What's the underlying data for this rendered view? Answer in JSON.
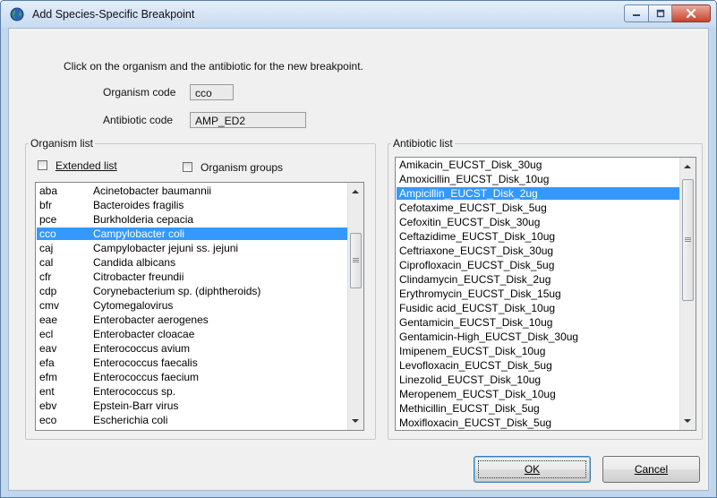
{
  "window": {
    "title": "Add Species-Specific Breakpoint",
    "icon": "globe-icon",
    "controls": [
      "minimize-icon",
      "maximize-icon",
      "close-icon"
    ]
  },
  "instructions": "Click on the organism and the antibiotic for the new breakpoint.",
  "organism_code": {
    "label": "Organism code",
    "value": "cco"
  },
  "antibiotic_code": {
    "label": "Antibiotic code",
    "value": "AMP_ED2"
  },
  "organism_list": {
    "legend": "Organism list",
    "extended_list_label": "Extended list",
    "extended_list_checked": false,
    "organism_groups_label": "Organism groups",
    "organism_groups_checked": false,
    "selected_index": 3,
    "items": [
      {
        "code": "aba",
        "name": "Acinetobacter baumannii"
      },
      {
        "code": "bfr",
        "name": "Bacteroides fragilis"
      },
      {
        "code": "pce",
        "name": "Burkholderia cepacia"
      },
      {
        "code": "cco",
        "name": "Campylobacter coli"
      },
      {
        "code": "caj",
        "name": "Campylobacter jejuni ss. jejuni"
      },
      {
        "code": "cal",
        "name": "Candida albicans"
      },
      {
        "code": "cfr",
        "name": "Citrobacter freundii"
      },
      {
        "code": "cdp",
        "name": "Corynebacterium sp. (diphtheroids)"
      },
      {
        "code": "cmv",
        "name": "Cytomegalovirus"
      },
      {
        "code": "eae",
        "name": "Enterobacter aerogenes"
      },
      {
        "code": "ecl",
        "name": "Enterobacter cloacae"
      },
      {
        "code": "eav",
        "name": "Enterococcus avium"
      },
      {
        "code": "efa",
        "name": "Enterococcus faecalis"
      },
      {
        "code": "efm",
        "name": "Enterococcus faecium"
      },
      {
        "code": "ent",
        "name": "Enterococcus sp."
      },
      {
        "code": "ebv",
        "name": "Epstein-Barr virus"
      },
      {
        "code": "eco",
        "name": "Escherichia coli"
      }
    ]
  },
  "antibiotic_list": {
    "legend": "Antibiotic list",
    "selected_index": 2,
    "items": [
      "Amikacin_EUCST_Disk_30ug",
      "Amoxicillin_EUCST_Disk_10ug",
      "Ampicillin_EUCST_Disk_2ug",
      "Cefotaxime_EUCST_Disk_5ug",
      "Cefoxitin_EUCST_Disk_30ug",
      "Ceftazidime_EUCST_Disk_10ug",
      "Ceftriaxone_EUCST_Disk_30ug",
      "Ciprofloxacin_EUCST_Disk_5ug",
      "Clindamycin_EUCST_Disk_2ug",
      "Erythromycin_EUCST_Disk_15ug",
      "Fusidic acid_EUCST_Disk_10ug",
      "Gentamicin_EUCST_Disk_10ug",
      "Gentamicin-High_EUCST_Disk_30ug",
      "Imipenem_EUCST_Disk_10ug",
      "Levofloxacin_EUCST_Disk_5ug",
      "Linezolid_EUCST_Disk_10ug",
      "Meropenem_EUCST_Disk_10ug",
      "Methicillin_EUCST_Disk_5ug",
      "Moxifloxacin_EUCST_Disk_5ug"
    ]
  },
  "buttons": {
    "ok": "OK",
    "cancel": "Cancel"
  },
  "colors": {
    "selection": "#3399ff",
    "title_bar": "#c7dbf1",
    "close_button": "#c7452f"
  }
}
